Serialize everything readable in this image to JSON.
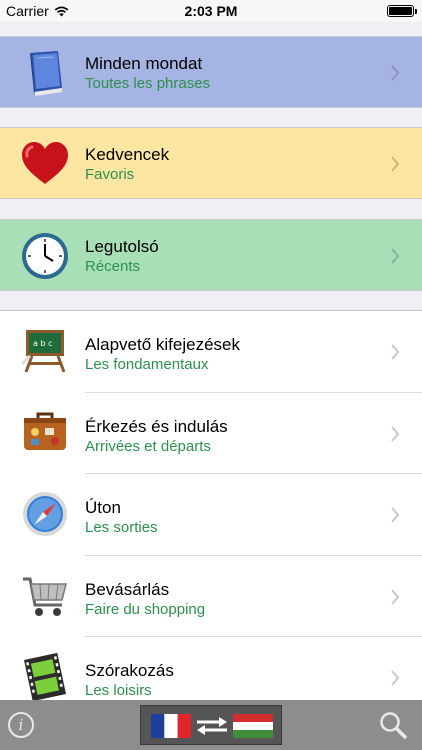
{
  "status_bar": {
    "carrier": "Carrier",
    "time": "2:03 PM"
  },
  "top_rows": [
    {
      "title": "Minden mondat",
      "subtitle": "Toutes les phrases",
      "icon": "book-icon"
    },
    {
      "title": "Kedvencek",
      "subtitle": "Favoris",
      "icon": "heart-icon"
    },
    {
      "title": "Legutolsó",
      "subtitle": "Récents",
      "icon": "clock-icon"
    }
  ],
  "categories": [
    {
      "title": "Alapvető kifejezések",
      "subtitle": "Les fondamentaux",
      "icon": "chalkboard-icon"
    },
    {
      "title": "Érkezés és indulás",
      "subtitle": "Arrivées et départs",
      "icon": "suitcase-icon"
    },
    {
      "title": "Úton",
      "subtitle": "Les sorties",
      "icon": "compass-icon"
    },
    {
      "title": "Bevásárlás",
      "subtitle": "Faire du shopping",
      "icon": "shopping-cart-icon"
    },
    {
      "title": "Szórakozás",
      "subtitle": "Les loisirs",
      "icon": "film-strip-icon"
    }
  ],
  "bottom_bar": {
    "info_symbol": "i",
    "language_pair": [
      "French",
      "Hungarian"
    ]
  },
  "colors": {
    "row_blue": "#a6b4e3",
    "row_yellow": "#fde6a2",
    "row_green": "#a8dfb7",
    "subtitle_green": "#2f8f4f",
    "bottom_bar": "#8d8d8d"
  }
}
